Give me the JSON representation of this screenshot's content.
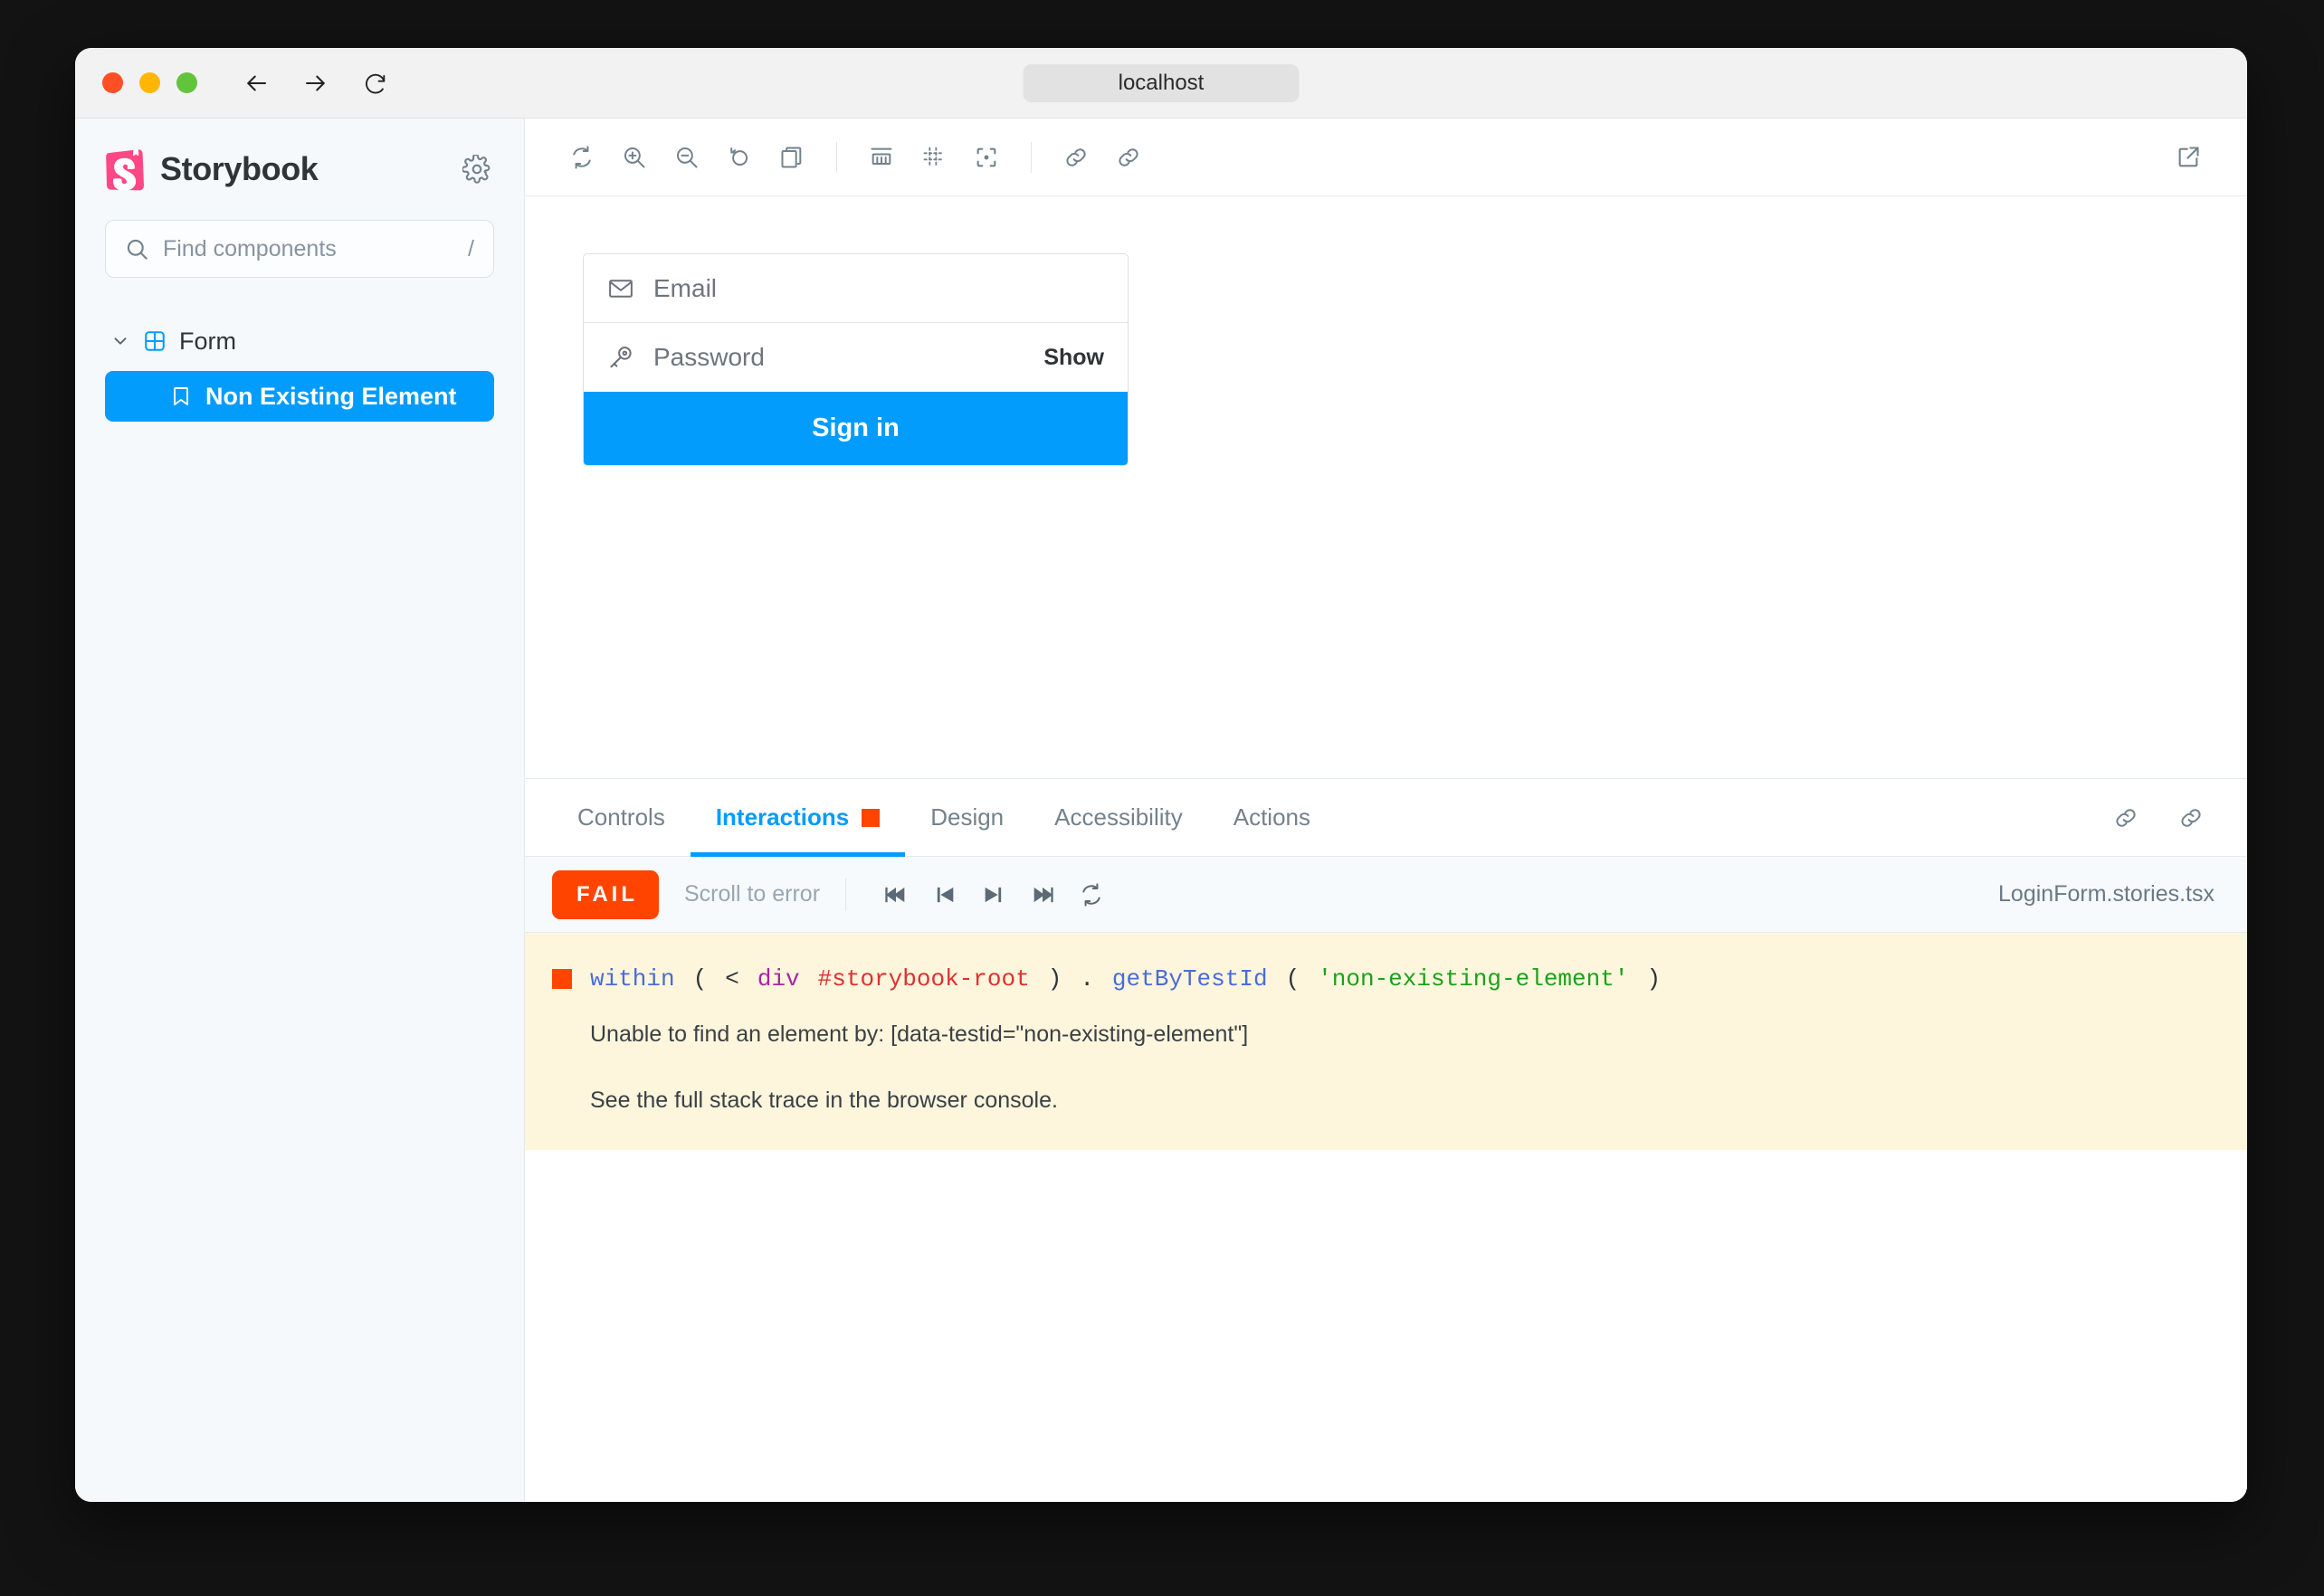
{
  "browser": {
    "url": "localhost",
    "nav": {
      "back": "back-arrow",
      "forward": "forward-arrow",
      "reload": "reload-icon"
    },
    "traffic_lights": [
      "close",
      "minimize",
      "maximize"
    ]
  },
  "sidebar": {
    "brand_title": "Storybook",
    "logo_icon": "storybook-logo",
    "settings_icon": "gear-icon",
    "search": {
      "placeholder": "Find components",
      "value": "",
      "shortcut_hint": "/",
      "icon": "search-icon"
    },
    "tree": {
      "group": {
        "label": "Form",
        "icon": "component-grid-icon",
        "expanded": true,
        "chevron": "chevron-down-icon"
      },
      "items": [
        {
          "label": "Non Existing Element",
          "icon": "bookmark-icon",
          "selected": true
        }
      ]
    }
  },
  "preview_toolbar": {
    "buttons": [
      {
        "name": "remount-button",
        "icon": "remount-icon"
      },
      {
        "name": "zoom-in-button",
        "icon": "zoom-in-icon"
      },
      {
        "name": "zoom-out-button",
        "icon": "zoom-out-icon"
      },
      {
        "name": "zoom-reset-button",
        "icon": "zoom-reset-icon"
      },
      {
        "name": "background-button",
        "icon": "copy-layers-icon"
      },
      {
        "name": "measure-button",
        "icon": "ruler-icon"
      },
      {
        "name": "grid-button",
        "icon": "grid-dots-icon"
      },
      {
        "name": "outline-button",
        "icon": "outline-icon"
      },
      {
        "name": "copy-link-button",
        "icon": "link-icon"
      },
      {
        "name": "share-link-button",
        "icon": "link-icon"
      }
    ],
    "open_new_tab_icon": "open-in-new-icon"
  },
  "story": {
    "email_field": {
      "placeholder": "Email",
      "value": "",
      "icon": "envelope-icon"
    },
    "password_field": {
      "placeholder": "Password",
      "value": "",
      "icon": "key-icon",
      "show_label": "Show"
    },
    "submit_label": "Sign in"
  },
  "panel": {
    "tabs": [
      {
        "label": "Controls",
        "active": false,
        "badge": null
      },
      {
        "label": "Interactions",
        "active": true,
        "badge": "error"
      },
      {
        "label": "Design",
        "active": false,
        "badge": null
      },
      {
        "label": "Accessibility",
        "active": false,
        "badge": null
      },
      {
        "label": "Actions",
        "active": false,
        "badge": null
      }
    ],
    "header_icons": [
      {
        "name": "panel-link-icon",
        "icon": "link-icon"
      },
      {
        "name": "panel-share-icon",
        "icon": "link-icon"
      }
    ]
  },
  "interactions": {
    "status_label": "FAIL",
    "scroll_to_error_label": "Scroll to error",
    "controls": [
      {
        "name": "go-to-start-button",
        "icon": "skip-back-icon"
      },
      {
        "name": "step-back-button",
        "icon": "step-back-icon"
      },
      {
        "name": "step-forward-button",
        "icon": "step-forward-icon"
      },
      {
        "name": "go-to-end-button",
        "icon": "skip-forward-icon"
      },
      {
        "name": "rerun-button",
        "icon": "rerun-icon"
      }
    ],
    "filename": "LoginForm.stories.tsx",
    "error": {
      "code_tokens": {
        "fn_within": "within",
        "open_paren": "(",
        "tag_open": "<",
        "tag_name": "div",
        "tag_id": "#storybook-root",
        "close_paren": ")",
        "dot": ".",
        "fn_getbytestid": "getByTestId",
        "open_paren2": "(",
        "string_arg": "'non-existing-element'",
        "close_paren2": ")"
      },
      "message_line_1": "Unable to find an element by: [data-testid=\"non-existing-element\"]",
      "message_line_2": "See the full stack trace in the browser console."
    }
  },
  "colors": {
    "brand_blue": "#029cfd",
    "storybook_pink": "#ff4785",
    "fail_orange": "#ff4400",
    "error_bg": "#fdf6dd",
    "sidebar_bg": "#f6f9fc",
    "text_primary": "#2e3438",
    "text_muted": "#73828c"
  }
}
